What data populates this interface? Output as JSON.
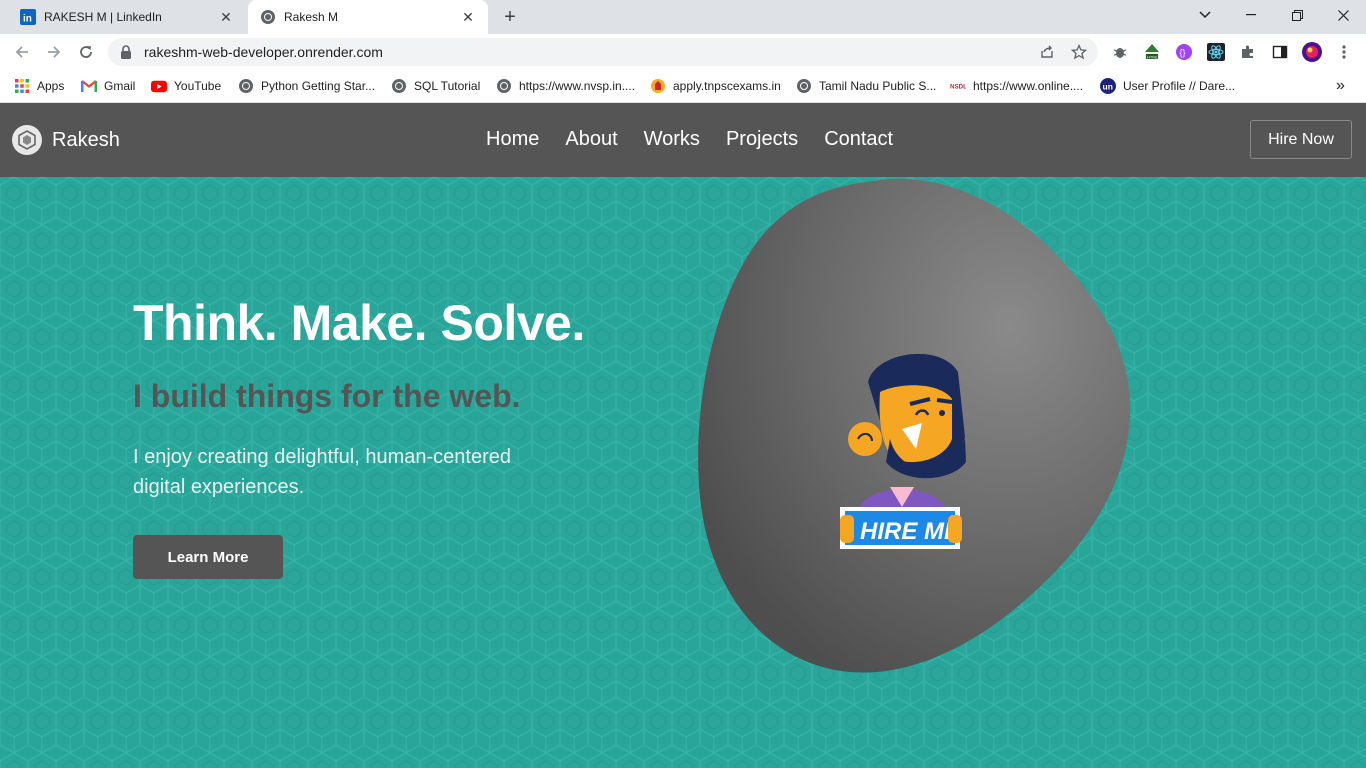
{
  "browser": {
    "tabs": [
      {
        "title": "RAKESH M | LinkedIn",
        "icon": "linkedin-icon",
        "active": false
      },
      {
        "title": "Rakesh M",
        "icon": "globe-icon",
        "active": true
      }
    ],
    "new_tab_label": "+",
    "url": "rakeshm-web-developer.onrender.com",
    "bookmarks": [
      {
        "label": "Apps",
        "icon": "apps-grid-icon"
      },
      {
        "label": "Gmail",
        "icon": "gmail-icon"
      },
      {
        "label": "YouTube",
        "icon": "youtube-icon"
      },
      {
        "label": "Python Getting Star...",
        "icon": "globe-icon"
      },
      {
        "label": "SQL Tutorial",
        "icon": "globe-icon"
      },
      {
        "label": "https://www.nvsp.in....",
        "icon": "globe-icon"
      },
      {
        "label": "apply.tnpscexams.in",
        "icon": "emblem-icon"
      },
      {
        "label": "Tamil Nadu Public S...",
        "icon": "globe-icon"
      },
      {
        "label": "https://www.online....",
        "icon": "nsdl-icon"
      },
      {
        "label": "User Profile // Dare...",
        "icon": "un-icon"
      }
    ],
    "more_bookmarks": "»"
  },
  "site": {
    "brand": "Rakesh",
    "nav": [
      "Home",
      "About",
      "Works",
      "Projects",
      "Contact"
    ],
    "hire_button": "Hire Now",
    "hero": {
      "headline": "Think. Make. Solve.",
      "subheadline": "I build things for the web.",
      "description": "I enjoy creating delightful, human-centered digital experiences.",
      "cta": "Learn More",
      "illustration_sign": "HIRE ME"
    },
    "colors": {
      "nav_bg": "#555555",
      "hero_bg": "#2aa59a",
      "button_bg": "#555555",
      "blob": "#6b6b6b"
    }
  }
}
